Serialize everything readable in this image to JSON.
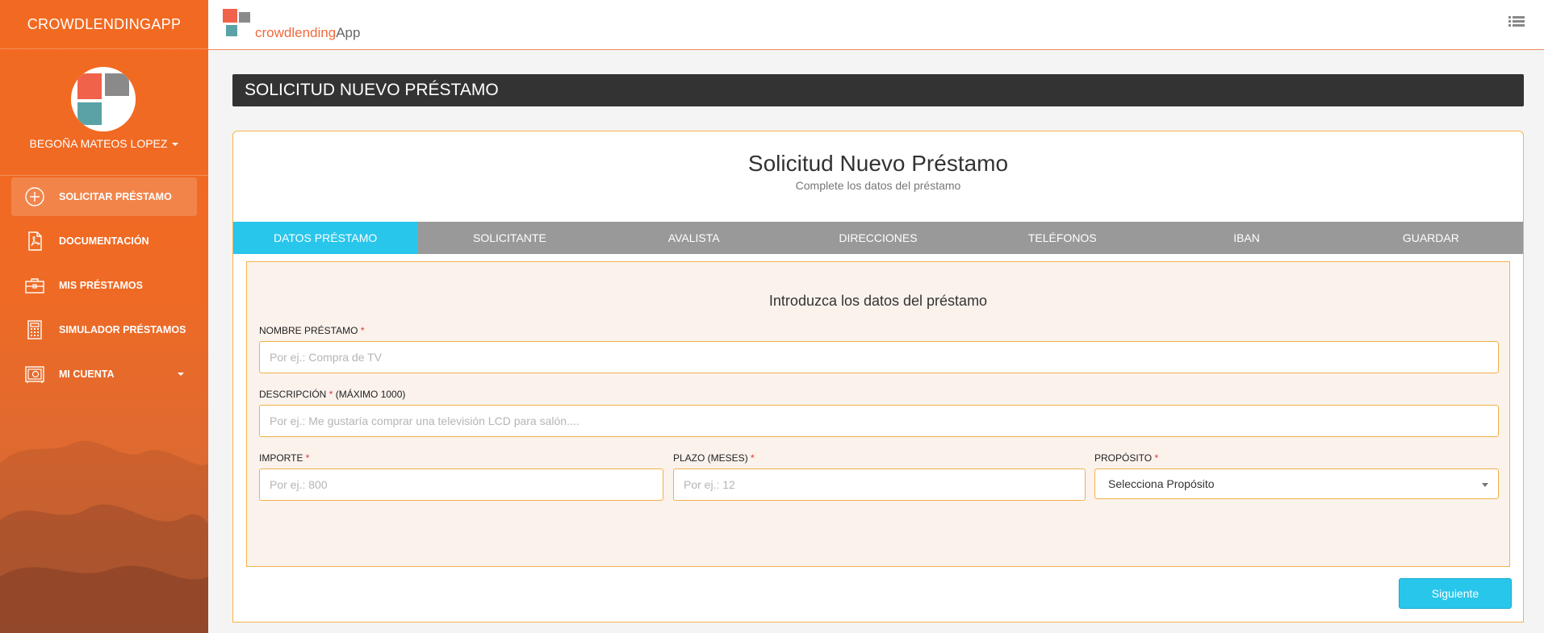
{
  "app": {
    "brand": "CROWDLENDINGAPP",
    "logo_text_1": "crowdlending",
    "logo_text_2": "App"
  },
  "colors": {
    "sidebar_orange": "#f26a22",
    "accent_cyan": "#29c6ec",
    "tab_gray": "#999999",
    "title_bar_dark": "#333333",
    "border_amber": "#f4b44a",
    "required_red": "#e0332f"
  },
  "user": {
    "name": "BEGOÑA MATEOS LOPEZ"
  },
  "sidebar": {
    "items": [
      {
        "label": "SOLICITAR PRÉSTAMO",
        "icon": "plus-circle-icon",
        "active": true
      },
      {
        "label": "DOCUMENTACIÓN",
        "icon": "pdf-document-icon"
      },
      {
        "label": "MIS PRÉSTAMOS",
        "icon": "briefcase-icon"
      },
      {
        "label": "SIMULADOR PRÉSTAMOS",
        "icon": "calculator-icon"
      },
      {
        "label": "MI CUENTA",
        "icon": "safe-icon",
        "has_dropdown": true
      }
    ]
  },
  "topbar": {
    "menu_icon": "list-menu-icon"
  },
  "page": {
    "title": "SOLICITUD NUEVO PRÉSTAMO"
  },
  "card": {
    "title": "Solicitud Nuevo Préstamo",
    "subtitle": "Complete los datos del préstamo"
  },
  "tabs": [
    {
      "label": "DATOS PRÉSTAMO",
      "active": true
    },
    {
      "label": "SOLICITANTE"
    },
    {
      "label": "AVALISTA"
    },
    {
      "label": "DIRECCIONES"
    },
    {
      "label": "TELÉFONOS"
    },
    {
      "label": "IBAN"
    },
    {
      "label": "GUARDAR"
    }
  ],
  "form": {
    "heading": "Introduzca los datos del préstamo",
    "nombre": {
      "label": "NOMBRE PRÉSTAMO",
      "required": "*",
      "placeholder": "Por ej.: Compra de TV"
    },
    "descripcion": {
      "label": "DESCRIPCIÓN",
      "required": "*",
      "suffix": "(MÁXIMO 1000)",
      "placeholder": "Por ej.: Me gustaría comprar una televisión LCD para salón...."
    },
    "importe": {
      "label": "IMPORTE",
      "required": "*",
      "placeholder": "Por ej.: 800"
    },
    "plazo": {
      "label": "PLAZO (MESES)",
      "required": "*",
      "placeholder": "Por ej.: 12"
    },
    "proposito": {
      "label": "PROPÓSITO",
      "required": "*",
      "selected": "Selecciona Propósito"
    }
  },
  "buttons": {
    "next": "Siguiente"
  }
}
